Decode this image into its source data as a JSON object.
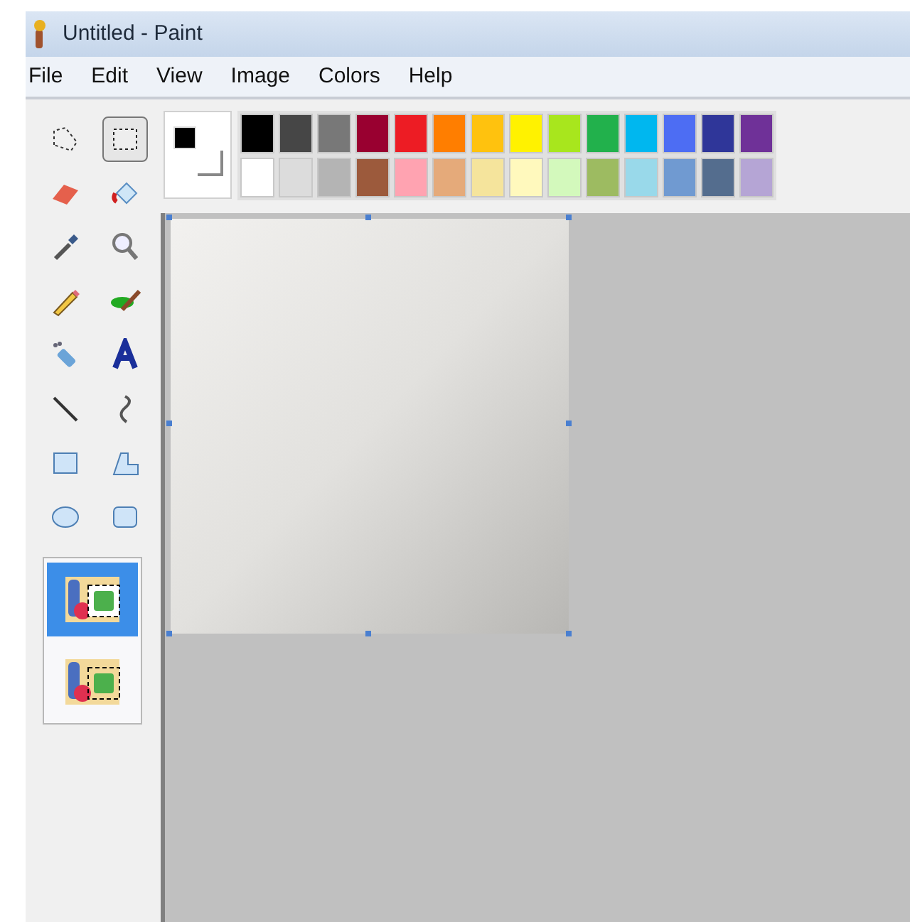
{
  "window": {
    "title": "Untitled - Paint"
  },
  "menu": [
    "File",
    "Edit",
    "View",
    "Image",
    "Colors",
    "Help"
  ],
  "tools": [
    {
      "selected": false
    },
    {
      "selected": true
    },
    {
      "selected": false
    },
    {
      "selected": false
    },
    {
      "selected": false
    },
    {
      "selected": false
    },
    {
      "selected": false
    },
    {
      "selected": false
    },
    {
      "selected": false
    },
    {
      "selected": false
    },
    {
      "selected": false
    },
    {
      "selected": false
    },
    {
      "selected": false
    },
    {
      "selected": false
    },
    {
      "selected": false
    },
    {
      "selected": false
    }
  ],
  "selection_modes": [
    {
      "selected": true
    },
    {
      "selected": false
    }
  ],
  "current_colors": {
    "foreground": {
      "color": "#000000"
    },
    "background": {
      "color": "#ffffff"
    }
  },
  "palette": [
    {
      "color": "#000000"
    },
    {
      "color": "#464646"
    },
    {
      "color": "#787878"
    },
    {
      "color": "#990030"
    },
    {
      "color": "#ed1c24"
    },
    {
      "color": "#ff7e00"
    },
    {
      "color": "#ffc20e"
    },
    {
      "color": "#fff200"
    },
    {
      "color": "#a8e61d"
    },
    {
      "color": "#22b14c"
    },
    {
      "color": "#00b7ef"
    },
    {
      "color": "#4d6df3"
    },
    {
      "color": "#2f3699"
    },
    {
      "color": "#6f3198"
    },
    {
      "color": "#ffffff"
    },
    {
      "color": "#dcdcdc"
    },
    {
      "color": "#b4b4b4"
    },
    {
      "color": "#9c5a3c"
    },
    {
      "color": "#ffa3b1"
    },
    {
      "color": "#e5aa7a"
    },
    {
      "color": "#f5e49c"
    },
    {
      "color": "#fff9bd"
    },
    {
      "color": "#d3f9bc"
    },
    {
      "color": "#9dbb61"
    },
    {
      "color": "#99d9ea"
    },
    {
      "color": "#709ad1"
    },
    {
      "color": "#546d8e"
    },
    {
      "color": "#b5a5d5"
    }
  ]
}
